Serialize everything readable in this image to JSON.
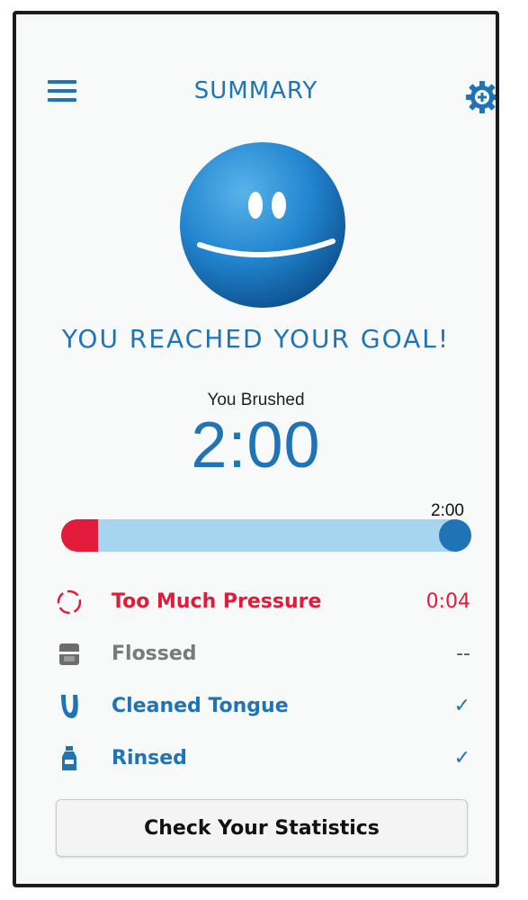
{
  "header": {
    "title": "SUMMARY",
    "menu_icon": "hamburger-menu-icon",
    "settings_icon": "gear-icon"
  },
  "result": {
    "mascot_icon": "smiley-face-icon",
    "goal_message": "YOU REACHED YOUR GOAL!",
    "brushed_label": "You Brushed",
    "brushed_time": "2:00"
  },
  "progress": {
    "goal_label": "2:00",
    "fraction_complete": 1.0,
    "pressure_fraction": 0.09
  },
  "stats": [
    {
      "icon": "pressure-target-icon",
      "label": "Too Much Pressure",
      "value": "0:04",
      "color": "#e21b3a"
    },
    {
      "icon": "floss-icon",
      "label": "Flossed",
      "value": "--",
      "color": "#7a7a7a"
    },
    {
      "icon": "tongue-icon",
      "label": "Cleaned Tongue",
      "value": "✓",
      "color": "#1f74b8"
    },
    {
      "icon": "rinse-bottle-icon",
      "label": "Rinsed",
      "value": "✓",
      "color": "#1f74b8"
    }
  ],
  "actions": {
    "statistics_button": "Check Your Statistics"
  },
  "colors": {
    "accent": "#1f74b8",
    "alert": "#e21b3a",
    "track": "#a7d4ef"
  }
}
